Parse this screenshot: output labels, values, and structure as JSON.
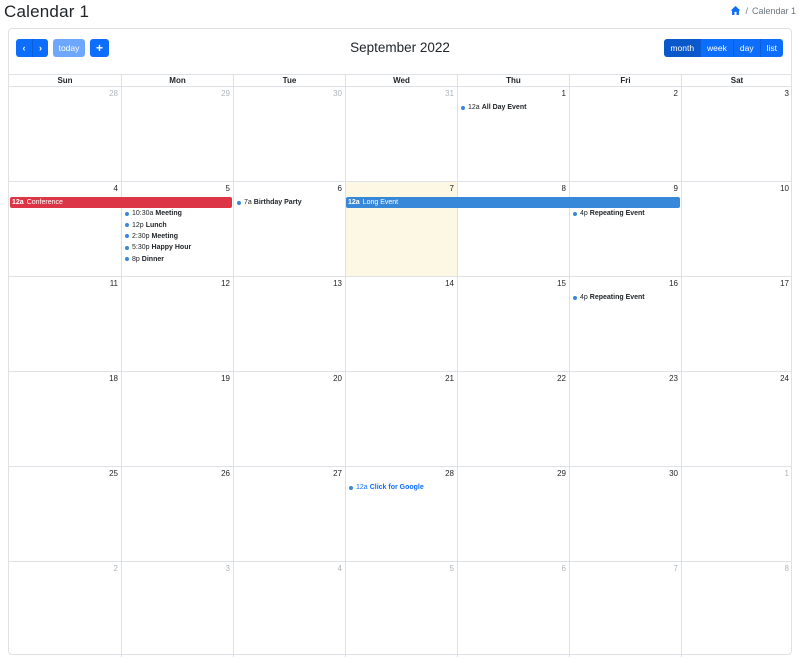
{
  "page": {
    "title": "Calendar 1",
    "breadcrumb": {
      "separator": "/",
      "current": "Calendar 1"
    }
  },
  "toolbar": {
    "prev_icon": "chevron-left-icon",
    "next_icon": "chevron-right-icon",
    "prev_glyph": "‹",
    "next_glyph": "›",
    "today_label": "today",
    "add_glyph": "+",
    "title": "September 2022",
    "views": [
      "month",
      "week",
      "day",
      "list"
    ],
    "active_view": "month"
  },
  "colors": {
    "primary": "#0d6efd",
    "today_bg": "#fcf8e3",
    "event_blue": "#3788d8",
    "event_red": "#dc3545"
  },
  "calendar": {
    "weekdays": [
      "Sun",
      "Mon",
      "Tue",
      "Wed",
      "Thu",
      "Fri",
      "Sat"
    ],
    "weeks": [
      [
        {
          "n": "28",
          "other": true
        },
        {
          "n": "29",
          "other": true
        },
        {
          "n": "30",
          "other": true
        },
        {
          "n": "31",
          "other": true
        },
        {
          "n": "1"
        },
        {
          "n": "2"
        },
        {
          "n": "3"
        }
      ],
      [
        {
          "n": "4"
        },
        {
          "n": "5"
        },
        {
          "n": "6"
        },
        {
          "n": "7",
          "today": true
        },
        {
          "n": "8"
        },
        {
          "n": "9"
        },
        {
          "n": "10"
        }
      ],
      [
        {
          "n": "11"
        },
        {
          "n": "12"
        },
        {
          "n": "13"
        },
        {
          "n": "14"
        },
        {
          "n": "15"
        },
        {
          "n": "16"
        },
        {
          "n": "17"
        }
      ],
      [
        {
          "n": "18"
        },
        {
          "n": "19"
        },
        {
          "n": "20"
        },
        {
          "n": "21"
        },
        {
          "n": "22"
        },
        {
          "n": "23"
        },
        {
          "n": "24"
        }
      ],
      [
        {
          "n": "25"
        },
        {
          "n": "26"
        },
        {
          "n": "27"
        },
        {
          "n": "28"
        },
        {
          "n": "29"
        },
        {
          "n": "30"
        },
        {
          "n": "1",
          "other": true
        }
      ],
      [
        {
          "n": "2",
          "other": true
        },
        {
          "n": "3",
          "other": true
        },
        {
          "n": "4",
          "other": true
        },
        {
          "n": "5",
          "other": true
        },
        {
          "n": "6",
          "other": true
        },
        {
          "n": "7",
          "other": true
        },
        {
          "n": "8",
          "other": true
        }
      ]
    ],
    "bars": [
      {
        "week": 1,
        "start": 0,
        "span": 2,
        "time": "12a",
        "title": "Conference",
        "color": "red"
      },
      {
        "week": 1,
        "start": 3,
        "span": 3,
        "time": "12a",
        "title": "Long Event",
        "color": "blue"
      }
    ],
    "events": [
      {
        "week": 0,
        "day": 4,
        "slot": 0,
        "time": "12a",
        "title": "All Day Event"
      },
      {
        "week": 1,
        "day": 1,
        "slot": 1,
        "time": "10:30a",
        "title": "Meeting"
      },
      {
        "week": 1,
        "day": 1,
        "slot": 2,
        "time": "12p",
        "title": "Lunch"
      },
      {
        "week": 1,
        "day": 1,
        "slot": 3,
        "time": "2:30p",
        "title": "Meeting"
      },
      {
        "week": 1,
        "day": 1,
        "slot": 4,
        "time": "5:30p",
        "title": "Happy Hour"
      },
      {
        "week": 1,
        "day": 1,
        "slot": 5,
        "time": "8p",
        "title": "Dinner"
      },
      {
        "week": 1,
        "day": 2,
        "slot": 0,
        "time": "7a",
        "title": "Birthday Party"
      },
      {
        "week": 1,
        "day": 5,
        "slot": 1,
        "time": "4p",
        "title": "Repeating Event"
      },
      {
        "week": 2,
        "day": 5,
        "slot": 0,
        "time": "4p",
        "title": "Repeating Event"
      },
      {
        "week": 4,
        "day": 3,
        "slot": 0,
        "time": "12a",
        "title": "Click for Google",
        "link": true
      }
    ]
  }
}
